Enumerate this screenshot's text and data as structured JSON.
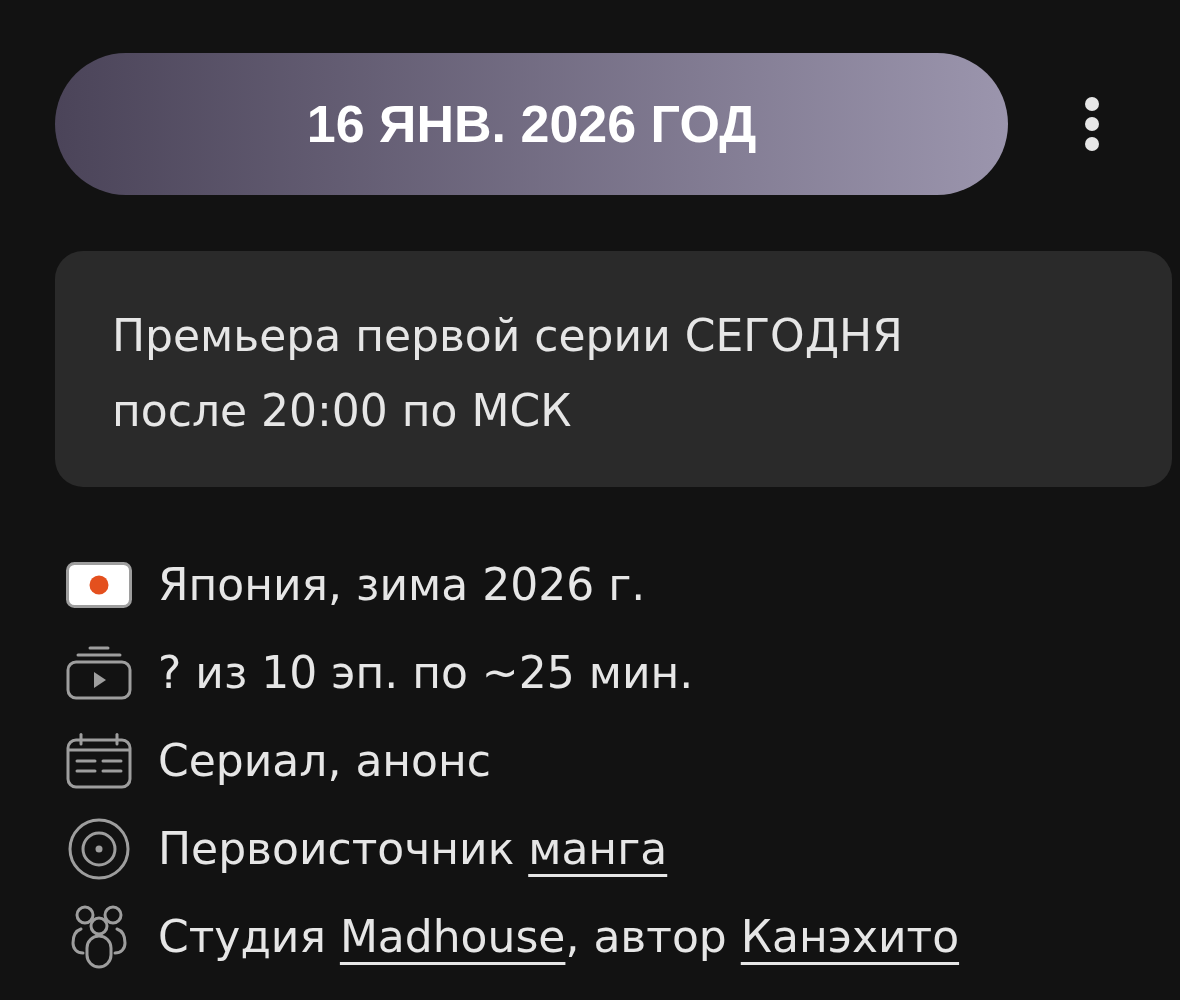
{
  "header": {
    "date": "16 ЯНВ. 2026 ГОД"
  },
  "notice": {
    "text": "Премьера первой серии СЕГОДНЯ после 20:00 по МСК"
  },
  "details": [
    {
      "kind": "flag",
      "segments": [
        {
          "kind": "text",
          "text": "Япония, зима 2026 г."
        }
      ]
    },
    {
      "kind": "episodes",
      "segments": [
        {
          "kind": "text",
          "text": "? из 10 эп. по ~25 мин."
        }
      ]
    },
    {
      "kind": "calendar",
      "segments": [
        {
          "kind": "text",
          "text": "Сериал, анонс"
        }
      ]
    },
    {
      "kind": "source",
      "segments": [
        {
          "kind": "text",
          "text": "Первоисточник "
        },
        {
          "kind": "link",
          "text": "манга"
        }
      ]
    },
    {
      "kind": "studio",
      "segments": [
        {
          "kind": "text",
          "text": "Студия "
        },
        {
          "kind": "link",
          "text": "Madhouse"
        },
        {
          "kind": "text",
          "text": ", автор "
        },
        {
          "kind": "link",
          "text": "Канэхито"
        }
      ]
    }
  ]
}
